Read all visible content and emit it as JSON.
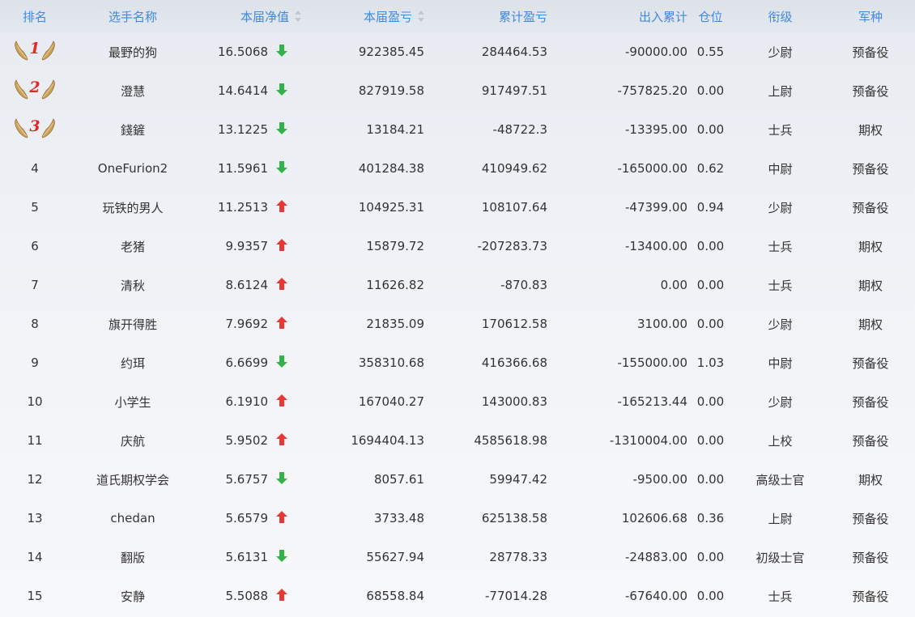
{
  "headers": {
    "rank": "排名",
    "name": "选手名称",
    "nav": "本届净值",
    "pl": "本届盈亏",
    "cum": "累计盈亏",
    "flow": "出入累计",
    "position": "仓位",
    "title": "衔级",
    "arm": "军种"
  },
  "colors": {
    "header_text": "#3f8ae0",
    "up": "#e53935",
    "down": "#34b24a",
    "medal_num": "#e02a2a"
  },
  "rows": [
    {
      "rank": "1",
      "name": "最野的狗",
      "nav": "16.5068",
      "trend": "down",
      "pl": "922385.45",
      "cum": "284464.53",
      "flow": "-90000.00",
      "position": "0.55",
      "title": "少尉",
      "arm": "预备役"
    },
    {
      "rank": "2",
      "name": "澄慧",
      "nav": "14.6414",
      "trend": "down",
      "pl": "827919.58",
      "cum": "917497.51",
      "flow": "-757825.20",
      "position": "0.00",
      "title": "上尉",
      "arm": "预备役"
    },
    {
      "rank": "3",
      "name": "錢鏟",
      "nav": "13.1225",
      "trend": "down",
      "pl": "13184.21",
      "cum": "-48722.3",
      "flow": "-13395.00",
      "position": "0.00",
      "title": "士兵",
      "arm": "期权"
    },
    {
      "rank": "4",
      "name": "OneFurion2",
      "nav": "11.5961",
      "trend": "down",
      "pl": "401284.38",
      "cum": "410949.62",
      "flow": "-165000.00",
      "position": "0.62",
      "title": "中尉",
      "arm": "预备役"
    },
    {
      "rank": "5",
      "name": "玩铁的男人",
      "nav": "11.2513",
      "trend": "up",
      "pl": "104925.31",
      "cum": "108107.64",
      "flow": "-47399.00",
      "position": "0.94",
      "title": "少尉",
      "arm": "预备役"
    },
    {
      "rank": "6",
      "name": "老猪",
      "nav": "9.9357",
      "trend": "up",
      "pl": "15879.72",
      "cum": "-207283.73",
      "flow": "-13400.00",
      "position": "0.00",
      "title": "士兵",
      "arm": "期权"
    },
    {
      "rank": "7",
      "name": "清秋",
      "nav": "8.6124",
      "trend": "up",
      "pl": "11626.82",
      "cum": "-870.83",
      "flow": "0.00",
      "position": "0.00",
      "title": "士兵",
      "arm": "期权"
    },
    {
      "rank": "8",
      "name": "旗开得胜",
      "nav": "7.9692",
      "trend": "up",
      "pl": "21835.09",
      "cum": "170612.58",
      "flow": "3100.00",
      "position": "0.00",
      "title": "少尉",
      "arm": "期权"
    },
    {
      "rank": "9",
      "name": "约珥",
      "nav": "6.6699",
      "trend": "down",
      "pl": "358310.68",
      "cum": "416366.68",
      "flow": "-155000.00",
      "position": "1.03",
      "title": "中尉",
      "arm": "预备役"
    },
    {
      "rank": "10",
      "name": "小学生",
      "nav": "6.1910",
      "trend": "up",
      "pl": "167040.27",
      "cum": "143000.83",
      "flow": "-165213.44",
      "position": "0.00",
      "title": "少尉",
      "arm": "预备役"
    },
    {
      "rank": "11",
      "name": "庆航",
      "nav": "5.9502",
      "trend": "up",
      "pl": "1694404.13",
      "cum": "4585618.98",
      "flow": "-1310004.00",
      "position": "0.00",
      "title": "上校",
      "arm": "预备役"
    },
    {
      "rank": "12",
      "name": "道氏期权学会",
      "nav": "5.6757",
      "trend": "down",
      "pl": "8057.61",
      "cum": "59947.42",
      "flow": "-9500.00",
      "position": "0.00",
      "title": "高级士官",
      "arm": "期权"
    },
    {
      "rank": "13",
      "name": "chedan",
      "nav": "5.6579",
      "trend": "up",
      "pl": "3733.48",
      "cum": "625138.58",
      "flow": "102606.68",
      "position": "0.36",
      "title": "上尉",
      "arm": "预备役"
    },
    {
      "rank": "14",
      "name": "翻版",
      "nav": "5.6131",
      "trend": "down",
      "pl": "55627.94",
      "cum": "28778.33",
      "flow": "-24883.00",
      "position": "0.00",
      "title": "初级士官",
      "arm": "预备役"
    },
    {
      "rank": "15",
      "name": "安静",
      "nav": "5.5088",
      "trend": "up",
      "pl": "68558.84",
      "cum": "-77014.28",
      "flow": "-67640.00",
      "position": "0.00",
      "title": "士兵",
      "arm": "预备役"
    }
  ]
}
